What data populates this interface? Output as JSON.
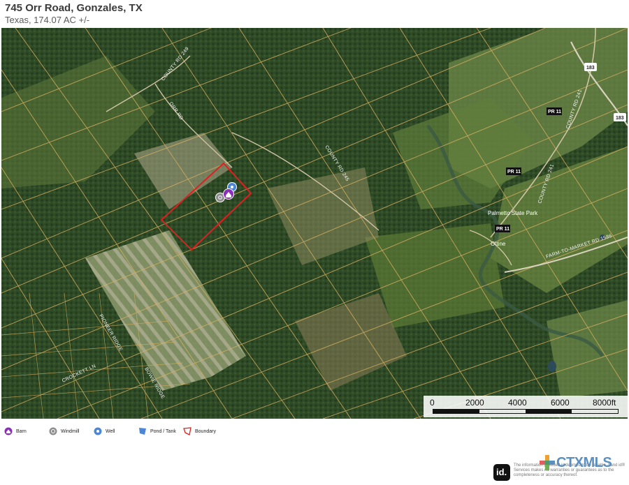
{
  "header": {
    "title": "745 Orr Road, Gonzales, TX",
    "subtitle": "Texas, 174.07 AC +/-"
  },
  "map": {
    "road_labels": {
      "county_rd_249": "COUNTY RD 249",
      "orr_rd": "ORR RD",
      "county_rd_245": "COUNTY RD 245",
      "county_rd_241": "COUNTY RD 241",
      "county_rd_241b": "COUNTY RD 241",
      "fm_1586": "FARM-TO-MARKET RD 1586",
      "hwy_183a": "183",
      "hwy_183b": "183",
      "pr11a": "PR 11",
      "pr11b": "PR 11",
      "pr11c": "PR 11",
      "palmetto": "Palmetto State Park",
      "ottine": "Ottine",
      "crockett": "CROCKETT LN",
      "pioneer": "PIONEER RIDGE",
      "bowie": "BOWIE RIDGE"
    },
    "colors": {
      "boundary": "#e02020",
      "parcel_lines": "#d8b060",
      "barn": "#8a2fb8",
      "well": "#4d86d6",
      "windmill": "#8e8e8e"
    }
  },
  "scale": {
    "labels": [
      "0",
      "2000",
      "4000",
      "6000",
      "8000ft"
    ]
  },
  "legend": {
    "barn": "Barn",
    "windmill": "Windmill",
    "well": "Well",
    "pond": "Pond / Tank",
    "boundary": "Boundary"
  },
  "footer": {
    "logo": "id.",
    "ctx_brand": "CTXMLS",
    "disclaimer": "The information provided is deemed to be reliable. Land id® Services makes no warranties or guarantees as to the completeness or accuracy thereof."
  }
}
